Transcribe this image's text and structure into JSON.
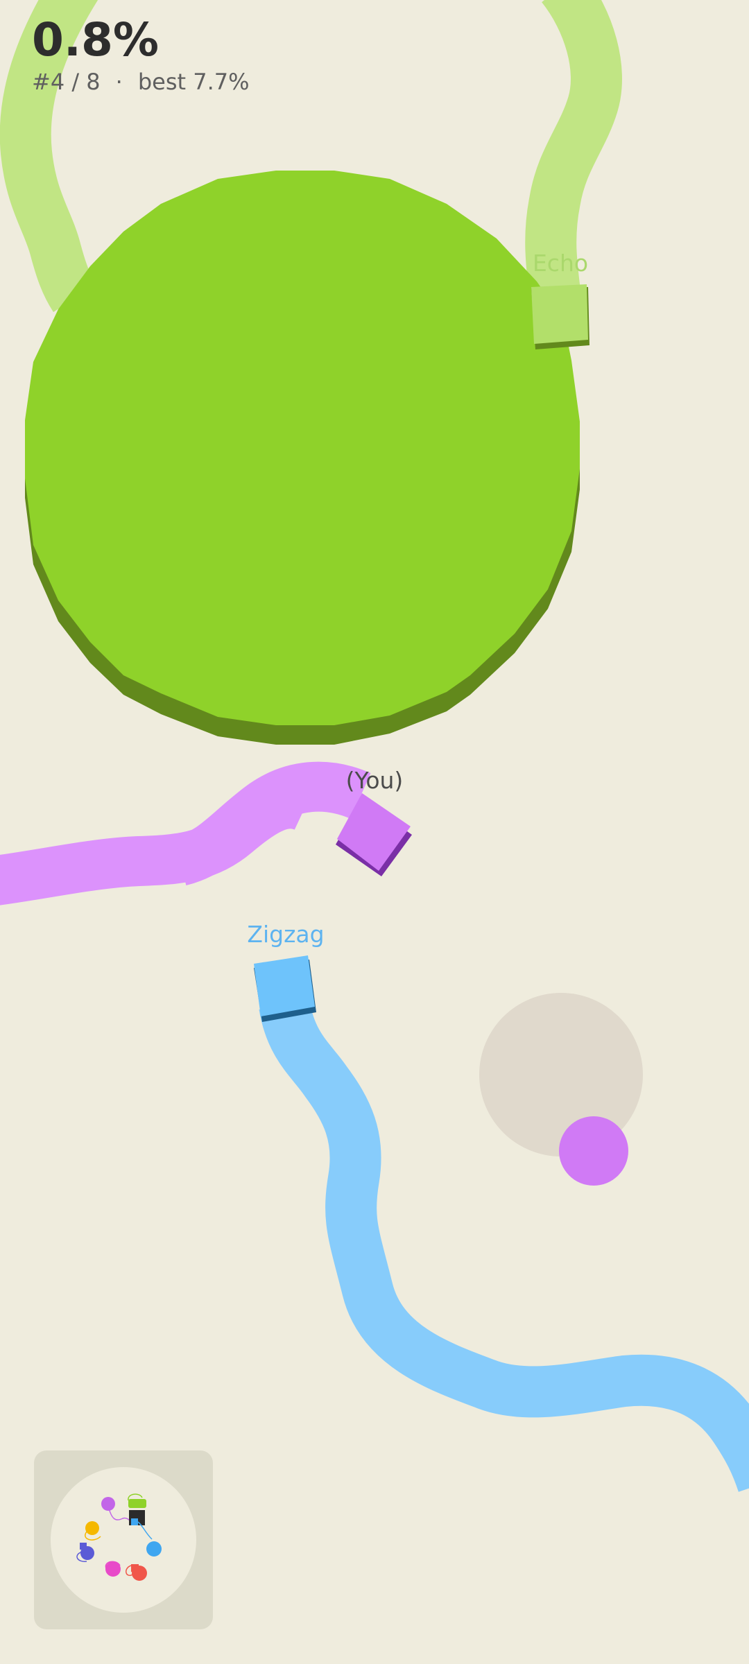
{
  "hud": {
    "percent": "0.8%",
    "rank": "#4 / 8",
    "separator": "·",
    "best": "best 7.7%"
  },
  "players": {
    "you": {
      "label": "(You)",
      "color": "#d98efa",
      "head_color": "#d07af5"
    },
    "echo": {
      "label": "Echo",
      "color": "#8fd22a",
      "trail_color": "#c1e584"
    },
    "zigzag": {
      "label": "Zigzag",
      "color": "#87ccfb",
      "head_color": "#6ec3fb"
    }
  },
  "colors": {
    "background": "#efecdd",
    "minimap_panel": "#dcdac9",
    "minimap_disc": "#efecdd",
    "pickup_shadow": "#e0d9cc",
    "pickup": "#d07af5"
  },
  "minimap": {
    "icon": "minimap-icon"
  }
}
